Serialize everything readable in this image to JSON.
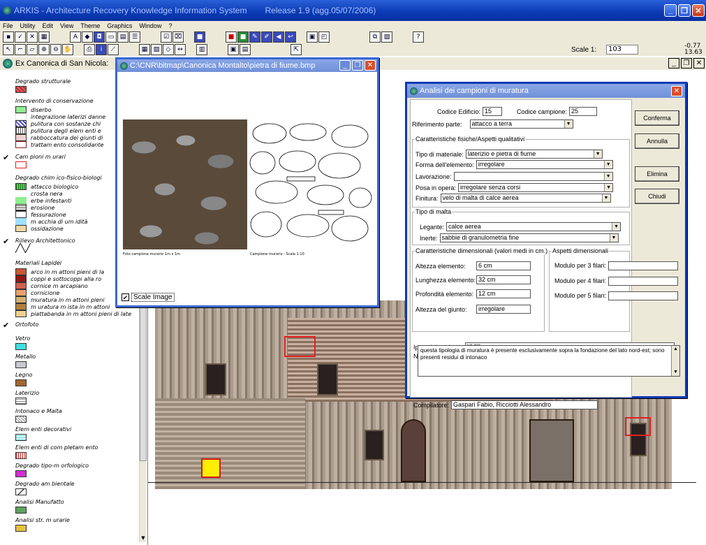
{
  "app": {
    "title": "ARKIS - Architecture Recovery Knowledge Information System",
    "release": "Release 1.9  (agg.05/07/2006)"
  },
  "menu": [
    "File",
    "Utility",
    "Edit",
    "View",
    "Theme",
    "Graphics",
    "Window",
    "?"
  ],
  "scale": {
    "label": "Scale 1:",
    "value": "103"
  },
  "coords": {
    "x": "-0.77",
    "y": "13.63"
  },
  "document": {
    "title": "Ex Canonica di San Nicola:"
  },
  "layers": [
    {
      "name": "Degrado strutturale",
      "checked": false,
      "color": "#d04848"
    },
    {
      "name": "Intervento di conservazione",
      "checked": false,
      "subitems": [
        {
          "name": "diserbo",
          "color": "#90ee90"
        },
        {
          "name": "integrazione laterizi danne",
          "color": "#ffffff"
        },
        {
          "name": "pulitura con sostanze chi",
          "color": "#4848c8"
        },
        {
          "name": "pulitura degli elem enti e",
          "color": "#e0e0f0"
        },
        {
          "name": "rabboccatura dei giunti di",
          "color": "#f0d0d0"
        },
        {
          "name": "trattam ento consolidante",
          "color": "#ffffff"
        }
      ]
    },
    {
      "name": "Cam pioni m urari",
      "checked": true,
      "color": "#ffffff"
    },
    {
      "name": "Degrado chim ico-fisico-biologi",
      "checked": false,
      "subitems": [
        {
          "name": "attacco biologico",
          "color": "#30a030"
        },
        {
          "name": "crosta nera",
          "color": "#ffffff"
        },
        {
          "name": "erbe infestanti",
          "color": "#90ee90"
        },
        {
          "name": "erosione",
          "color": "#ffffff"
        },
        {
          "name": "fessurazione",
          "color": "#ffffff"
        },
        {
          "name": "m acchia di um idità",
          "color": "#a0e0ff"
        },
        {
          "name": "ossidazione",
          "color": "#f0d8a8"
        }
      ]
    },
    {
      "name": "Rilievo Architettonico",
      "checked": true
    },
    {
      "name": "Materiali Lapidei",
      "checked": false,
      "subitems": [
        {
          "name": "arco in m attoni pieni di la",
          "color": "#c85838"
        },
        {
          "name": "coppi e sottocoppi alla ro",
          "color": "#901818"
        },
        {
          "name": "cornice m arcapiano",
          "color": "#d06050"
        },
        {
          "name": "cornicione",
          "color": "#e8a070"
        },
        {
          "name": "muratura in m attoni pieni",
          "color": "#d0b070"
        },
        {
          "name": "m uratura m ista in m attoni",
          "color": "#b08040"
        },
        {
          "name": "piattabanda in m attoni pieni di late",
          "color": "#f0d090"
        }
      ]
    },
    {
      "name": "Ortofoto",
      "checked": true
    },
    {
      "name": "Vetro",
      "checked": false,
      "color": "#40e0e0"
    },
    {
      "name": "Metallo",
      "checked": false,
      "color": "#c8c8d0"
    },
    {
      "name": "Legno",
      "checked": false,
      "color": "#a06830"
    },
    {
      "name": "Laterizio",
      "checked": false,
      "color": "#ffffff"
    },
    {
      "name": "Intonaco e Malta",
      "checked": false,
      "color": "#ffffff"
    },
    {
      "name": "Elem enti decorativi",
      "checked": false,
      "color": "#c8f0f0"
    },
    {
      "name": "Elem enti di com pletam ento",
      "checked": false,
      "color": "#d02020"
    },
    {
      "name": "Degrado tipo-m orfologico",
      "checked": false,
      "color": "#d030d0"
    },
    {
      "name": "Degrado am bientale",
      "checked": false,
      "color": "#ffffff"
    },
    {
      "name": "Analisi Manufatto",
      "checked": false,
      "color": "#60a060"
    },
    {
      "name": "Analisi str. m urarie",
      "checked": false,
      "color": "#e8c040"
    }
  ],
  "image_window": {
    "title": "C:\\CNR\\bitmap\\Canonica Montalto\\pietra di fiume.bmp",
    "caption_photo": "Foto campione murario 1m x 1m",
    "caption_sketch": "Campione murario - Scala 1:10",
    "scale_image_label": "Scale Image",
    "scale_image_checked": true
  },
  "dialog": {
    "title": "Analisi dei campioni di muratura",
    "codice_edificio_label": "Codice Edificio:",
    "codice_edificio": "15",
    "codice_campione_label": "Codice campione:",
    "codice_campione": "25",
    "riferimento_label": "Riferimento parte:",
    "riferimento": "attacco a terra",
    "group_fisiche": "Caratteristiche fisiche/Aspetti qualitativi",
    "tipo_materiale_label": "Tipo di materiale:",
    "tipo_materiale": "laterizio e pietra di fiume",
    "forma_label": "Forma dell'elemento:",
    "forma": "irregolare",
    "lavorazione_label": "Lavorazione:",
    "lavorazione": "",
    "posa_label": "Posa in opera:",
    "posa": "irregolare senza corsi",
    "finitura_label": "Finitura:",
    "finitura": "velo di malta di calce aerea",
    "group_malta": "Tipo di malta",
    "legante_label": "Legante:",
    "legante": "calce aerea",
    "inerte_label": "Inerte:",
    "inerte": "sabbie di granulometria fine",
    "group_dimensionali": "Caratteristiche dimensionali (valori medi in cm.)",
    "altezza_label": "Altezza elemento:",
    "altezza": "6 cm",
    "lunghezza_label": "Lunghezza elemento:",
    "lunghezza": "32 cm",
    "profondita_label": "Profondità elemento:",
    "profondita": "12 cm",
    "giunto_label": "Altezza del giunto:",
    "giunto": "irregolare",
    "group_aspetti": "Aspetti dimensionali",
    "modulo3_label": "Modulo per 3 filari:",
    "modulo3": "",
    "modulo4_label": "Modulo per 4 filari:",
    "modulo4": "",
    "modulo5_label": "Modulo per 5 filari:",
    "modulo5": "",
    "ipotesi_label": "Ipotesi datazione:",
    "ipotesi": "XVIII sec.",
    "note_label": "Note:",
    "note": "questa tipologia di muratura è presente  esclusivamente sopra la fondazione del lato nord-est; sono presenti residui di intonaco",
    "compilatore_label": "Compilatore:",
    "compilatore": "Gaspari Fabio, Ricciotti Alessandro",
    "btn_conferma": "Conferma",
    "btn_annulla": "Annulla",
    "btn_elimina": "Elimina",
    "btn_chiudi": "Chiudi"
  }
}
